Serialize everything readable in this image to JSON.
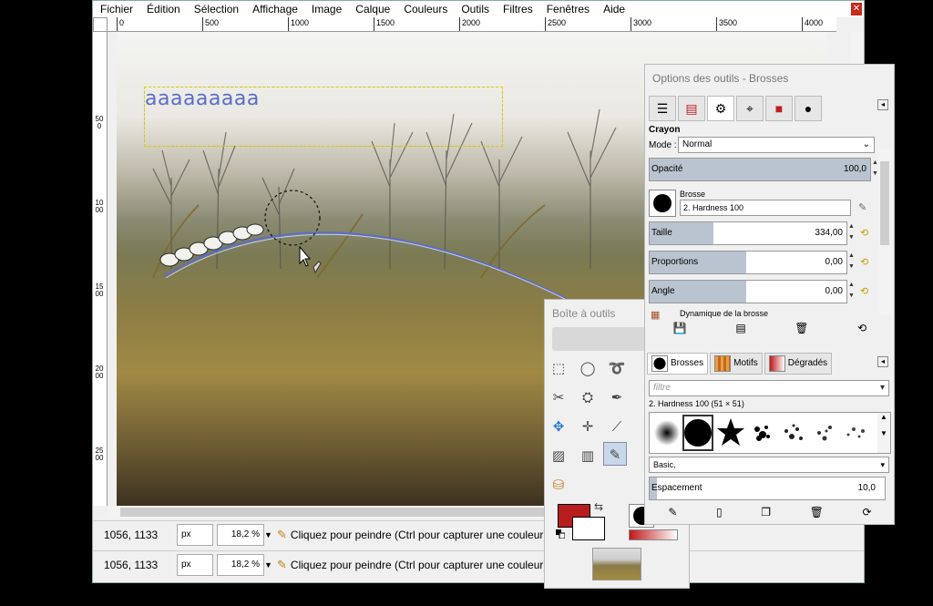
{
  "menubar": {
    "items": [
      "Fichier",
      "Édition",
      "Sélection",
      "Affichage",
      "Image",
      "Calque",
      "Couleurs",
      "Outils",
      "Filtres",
      "Fenêtres",
      "Aide"
    ]
  },
  "ruler": {
    "top_ticks": [
      "0",
      "500",
      "1000",
      "1500",
      "2000",
      "2500",
      "3000",
      "3500",
      "4000"
    ],
    "left_ticks": [
      "500",
      "1000",
      "1500",
      "2000",
      "2500"
    ]
  },
  "canvas": {
    "text_layer": "aaaaaaaaa"
  },
  "status_top": {
    "coords": "1056, 1133",
    "unit": "px",
    "zoom": "18,2 %",
    "message": "Cliquez pour peindre (Ctrl pour capturer une couleur)"
  },
  "status_bottom": {
    "coords": "1056, 1133",
    "unit": "px",
    "zoom": "18,2 %",
    "message": "Cliquez pour peindre (Ctrl pour capturer une couleur)"
  },
  "toolbox": {
    "title": "Boîte à outils",
    "fg_color": "#b81c1c",
    "bg_color": "#ffffff"
  },
  "tool_options": {
    "title": "Options des outils - Brosses",
    "tool_name": "Crayon",
    "mode_label": "Mode :",
    "mode_value": "Normal",
    "opacity_label": "Opacité",
    "opacity_value": "100,0",
    "brush_label": "Brosse",
    "brush_value": "2. Hardness 100",
    "size_label": "Taille",
    "size_value": "334,00",
    "proportions_label": "Proportions",
    "proportions_value": "0,00",
    "angle_label": "Angle",
    "angle_value": "0,00",
    "dynamics_label": "Dynamique de la brosse"
  },
  "brushes": {
    "tabs": [
      "Brosses",
      "Motifs",
      "Dégradés"
    ],
    "filter_placeholder": "filtre",
    "selected_caption": "2. Hardness 100 (51 × 51)",
    "tag_value": "Basic,",
    "spacing_label": "Espacement",
    "spacing_value": "10,0"
  },
  "colors": {
    "accent": "#b9c4d0",
    "stroke": "#5a6ec8"
  }
}
